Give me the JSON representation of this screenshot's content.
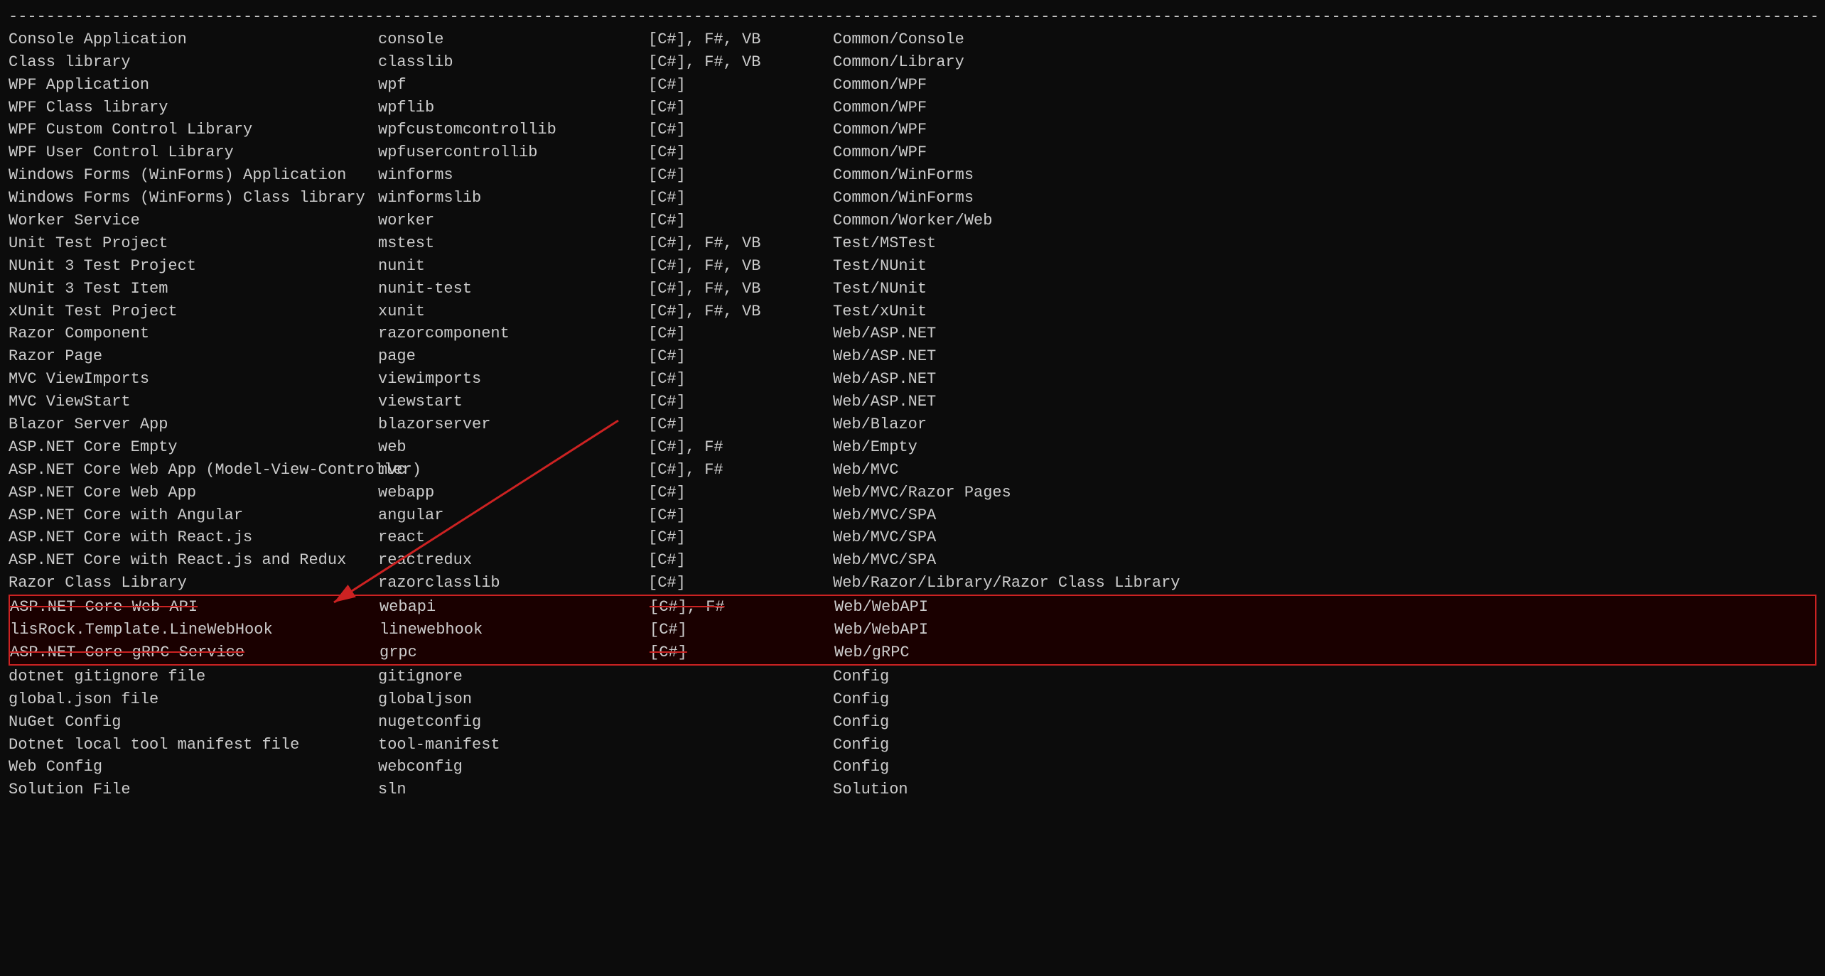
{
  "terminal": {
    "separator": "----------------------------------------------------------------------------------------------------------------------------------------------------------------------------------------------------",
    "rows": [
      {
        "name": "Console Application",
        "short": "console",
        "lang": "[C#], F#, VB",
        "tags": "Common/Console"
      },
      {
        "name": "Class library",
        "short": "classlib",
        "lang": "[C#], F#, VB",
        "tags": "Common/Library"
      },
      {
        "name": "WPF Application",
        "short": "wpf",
        "lang": "[C#]",
        "tags": "Common/WPF"
      },
      {
        "name": "WPF Class library",
        "short": "wpflib",
        "lang": "[C#]",
        "tags": "Common/WPF"
      },
      {
        "name": "WPF Custom Control Library",
        "short": "wpfcustomcontrollib",
        "lang": "[C#]",
        "tags": "Common/WPF"
      },
      {
        "name": "WPF User Control Library",
        "short": "wpfusercontrollib",
        "lang": "[C#]",
        "tags": "Common/WPF"
      },
      {
        "name": "Windows Forms (WinForms) Application",
        "short": "winforms",
        "lang": "[C#]",
        "tags": "Common/WinForms"
      },
      {
        "name": "Windows Forms (WinForms) Class library",
        "short": "winformslib",
        "lang": "[C#]",
        "tags": "Common/WinForms"
      },
      {
        "name": "Worker Service",
        "short": "worker",
        "lang": "[C#]",
        "tags": "Common/Worker/Web"
      },
      {
        "name": "Unit Test Project",
        "short": "mstest",
        "lang": "[C#], F#, VB",
        "tags": "Test/MSTest"
      },
      {
        "name": "NUnit 3 Test Project",
        "short": "nunit",
        "lang": "[C#], F#, VB",
        "tags": "Test/NUnit"
      },
      {
        "name": "NUnit 3 Test Item",
        "short": "nunit-test",
        "lang": "[C#], F#, VB",
        "tags": "Test/NUnit"
      },
      {
        "name": "xUnit Test Project",
        "short": "xunit",
        "lang": "[C#], F#, VB",
        "tags": "Test/xUnit"
      },
      {
        "name": "Razor Component",
        "short": "razorcomponent",
        "lang": "[C#]",
        "tags": "Web/ASP.NET"
      },
      {
        "name": "Razor Page",
        "short": "page",
        "lang": "[C#]",
        "tags": "Web/ASP.NET"
      },
      {
        "name": "MVC ViewImports",
        "short": "viewimports",
        "lang": "[C#]",
        "tags": "Web/ASP.NET"
      },
      {
        "name": "MVC ViewStart",
        "short": "viewstart",
        "lang": "[C#]",
        "tags": "Web/ASP.NET"
      },
      {
        "name": "Blazor Server App",
        "short": "blazorserver",
        "lang": "[C#]",
        "tags": "Web/Blazor"
      },
      {
        "name": "ASP.NET Core Empty",
        "short": "web",
        "lang": "[C#], F#",
        "tags": "Web/Empty"
      },
      {
        "name": "ASP.NET Core Web App (Model-View-Controller)",
        "short": "mvc",
        "lang": "[C#], F#",
        "tags": "Web/MVC"
      },
      {
        "name": "ASP.NET Core Web App",
        "short": "webapp",
        "lang": "[C#]",
        "tags": "Web/MVC/Razor Pages"
      },
      {
        "name": "ASP.NET Core with Angular",
        "short": "angular",
        "lang": "[C#]",
        "tags": "Web/MVC/SPA"
      },
      {
        "name": "ASP.NET Core with React.js",
        "short": "react",
        "lang": "[C#]",
        "tags": "Web/MVC/SPA"
      },
      {
        "name": "ASP.NET Core with React.js and Redux",
        "short": "reactredux",
        "lang": "[C#]",
        "tags": "Web/MVC/SPA"
      },
      {
        "name": "Razor Class Library",
        "short": "razorclasslib",
        "lang": "[C#]",
        "tags": "Web/Razor/Library/Razor Class Library"
      },
      {
        "name": "ASP.NET Core Web API",
        "short": "webapi",
        "lang": "[C#], F#",
        "tags": "Web/WebAPI",
        "highlight": true,
        "strikethrough": true
      },
      {
        "name": "lisRock.Template.LineWebHook",
        "short": "linewebhook",
        "lang": "[C#]",
        "tags": "Web/WebAPI",
        "highlight": true
      },
      {
        "name": "ASP.NET Core gRPC Service",
        "short": "grpc",
        "lang": "[C#]",
        "tags": "Web/gRPC",
        "highlight": true,
        "strikethrough": true
      },
      {
        "name": "dotnet gitignore file",
        "short": "gitignore",
        "lang": "",
        "tags": "Config"
      },
      {
        "name": "global.json file",
        "short": "globaljson",
        "lang": "",
        "tags": "Config"
      },
      {
        "name": "NuGet Config",
        "short": "nugetconfig",
        "lang": "",
        "tags": "Config"
      },
      {
        "name": "Dotnet local tool manifest file",
        "short": "tool-manifest",
        "lang": "",
        "tags": "Config"
      },
      {
        "name": "Web Config",
        "short": "webconfig",
        "lang": "",
        "tags": "Config"
      },
      {
        "name": "Solution File",
        "short": "sln",
        "lang": "",
        "tags": "Solution"
      }
    ]
  }
}
